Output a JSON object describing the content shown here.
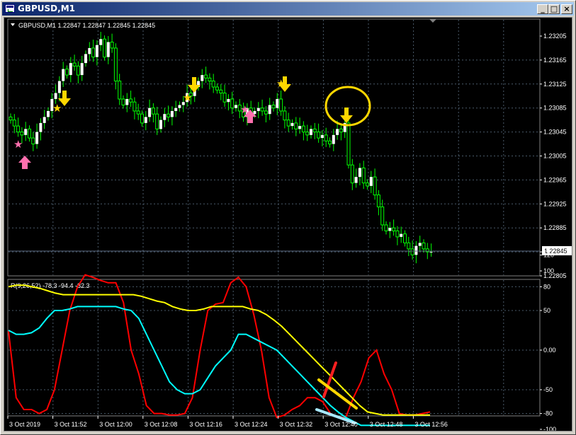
{
  "window": {
    "title": "GBPUSD,M1",
    "icon": "chart-window-icon",
    "controls": [
      {
        "name": "minimize-button",
        "glyph": "_"
      },
      {
        "name": "maximize-button",
        "glyph": "□"
      },
      {
        "name": "close-button",
        "glyph": "×"
      }
    ]
  },
  "main_chart": {
    "header": "GBPUSD,M1  1.22847 1.22847 1.22845 1.22845",
    "current_price_label": "1.22845",
    "price_ticks": [
      "1.23205",
      "1.23165",
      "1.23125",
      "1.23085",
      "1.23045",
      "1.23005",
      "1.22965",
      "1.22925",
      "1.22885",
      "1.22845",
      "1.22805"
    ]
  },
  "indicator": {
    "header": "R(9,26,52) -78.3 -94.4 -82.3",
    "ticks": [
      "120",
      "100",
      "80",
      "50",
      "0.00",
      "-50",
      "-80",
      "-100"
    ]
  },
  "time_labels": [
    "3 Oct 2019",
    "3 Oct 11:52",
    "3 Oct 12:00",
    "3 Oct 12:08",
    "3 Oct 12:16",
    "3 Oct 12:24",
    "3 Oct 12:32",
    "3 Oct 12:40",
    "3 Oct 12:48",
    "3 Oct 12:56"
  ],
  "colors": {
    "background": "#000000",
    "bull_candle": "#ffffff",
    "bear_candle": "#000000",
    "wick": "#00ff00",
    "grid": "#4a5a6a",
    "series_red": "#ff0000",
    "series_yellow": "#ffff00",
    "series_cyan": "#00ffff",
    "up_arrow": "#ff6fae",
    "down_arrow": "#ffd700"
  },
  "chart_data": {
    "type": "line",
    "series": [
      {
        "values": [
          24,
          -60,
          -75,
          -75,
          -80,
          -75,
          -50,
          0,
          50,
          80,
          95,
          92,
          88,
          85,
          85,
          60,
          0,
          -30,
          -70,
          -80,
          -80,
          -82,
          -82,
          -80,
          -60,
          0,
          50,
          58,
          60,
          85,
          92,
          80,
          45,
          0,
          -60,
          -85,
          -82,
          -75,
          -70,
          -60,
          -60,
          -65,
          -80,
          -85,
          -85,
          -60,
          -40,
          -10,
          0,
          -30,
          -50,
          -80,
          -82,
          -82,
          -80,
          -78
        ]
      },
      {
        "values": [
          80,
          82,
          82,
          80,
          78,
          75,
          72,
          70,
          70,
          70,
          70,
          70,
          70,
          70,
          70,
          70,
          70,
          68,
          65,
          62,
          60,
          55,
          52,
          50,
          50,
          52,
          55,
          55,
          55,
          55,
          55,
          52,
          50,
          45,
          38,
          30,
          20,
          10,
          0,
          -10,
          -20,
          -30,
          -40,
          -50,
          -60,
          -70,
          -78,
          -80,
          -82,
          -82,
          -82,
          -82,
          -82,
          -82,
          -82
        ]
      },
      {
        "values": [
          25,
          20,
          20,
          22,
          28,
          40,
          50,
          50,
          52,
          55,
          55,
          55,
          55,
          55,
          55,
          52,
          50,
          40,
          20,
          0,
          -20,
          -40,
          -50,
          -55,
          -55,
          -50,
          -35,
          -20,
          -10,
          0,
          20,
          20,
          15,
          10,
          5,
          0,
          -10,
          -20,
          -30,
          -40,
          -50,
          -60,
          -70,
          -78,
          -85,
          -90,
          -95,
          -95,
          -95,
          -95,
          -95,
          -95,
          -95,
          -95,
          -95,
          -95
        ]
      }
    ]
  }
}
